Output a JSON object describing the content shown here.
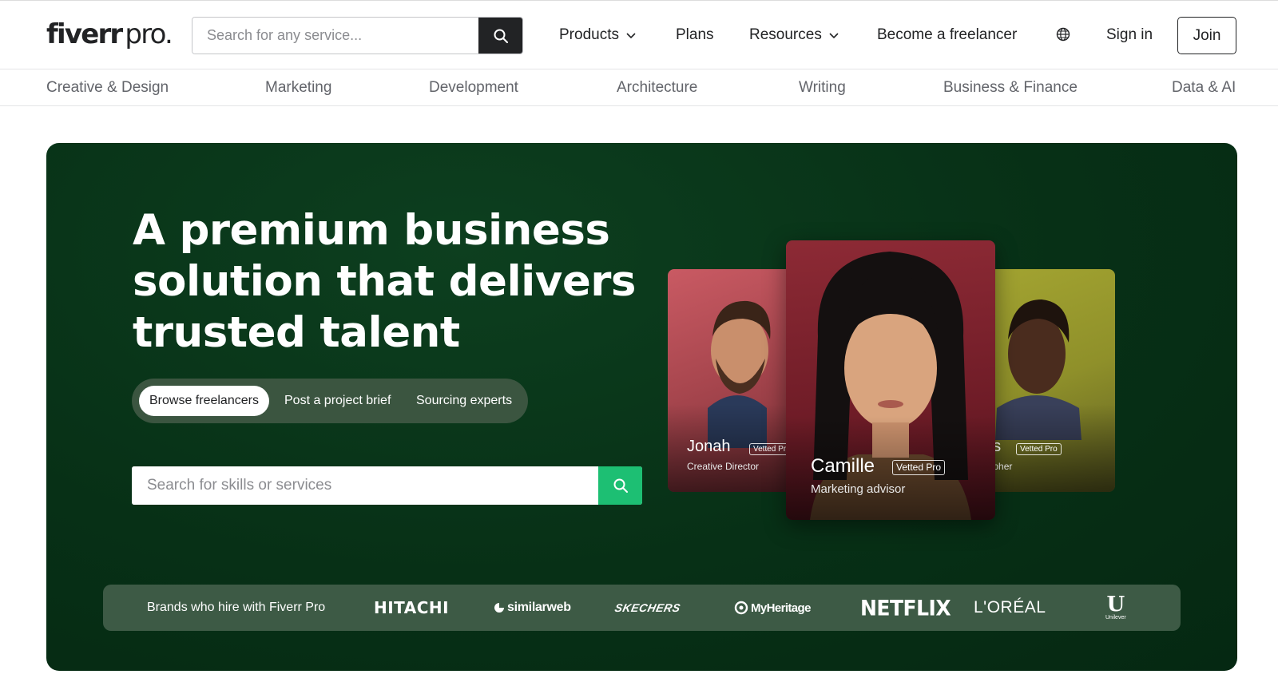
{
  "header": {
    "logo_word": "fiverr",
    "logo_suffix": "pro.",
    "search_placeholder": "Search for any service...",
    "nav": {
      "products": "Products",
      "plans": "Plans",
      "resources": "Resources",
      "become_freelancer": "Become a freelancer",
      "sign_in": "Sign in",
      "join": "Join"
    }
  },
  "categories": [
    "Creative & Design",
    "Marketing",
    "Development",
    "Architecture",
    "Writing",
    "Business & Finance",
    "Data & AI"
  ],
  "hero": {
    "title_lines": [
      "A premium business",
      "solution that delivers",
      "trusted talent"
    ],
    "tabs": [
      "Browse freelancers",
      "Post a project brief",
      "Sourcing experts"
    ],
    "active_tab": "Browse freelancers",
    "search_placeholder": "Search for skills or services"
  },
  "talent_cards": [
    {
      "name": "Jonah",
      "role": "Creative Director",
      "badge": "Vetted Pro"
    },
    {
      "name": "Camille",
      "role": "Marketing advisor",
      "badge": "Vetted Pro"
    },
    {
      "name": "es",
      "role": "grapher",
      "badge": "Vetted Pro"
    }
  ],
  "brands": {
    "label": "Brands who hire with Fiverr Pro",
    "logos": [
      "HITACHI",
      "similarweb",
      "SKECHERS",
      "MyHeritage",
      "NETFLIX",
      "L'ORÉAL",
      "Unilever"
    ]
  },
  "colors": {
    "hero_bg": "#073016",
    "brand_green": "#1dbf73",
    "brands_strip": "#3d5a45",
    "text_dark": "#222325"
  },
  "icons": [
    "search-icon",
    "chevron-down-icon",
    "globe-icon"
  ]
}
